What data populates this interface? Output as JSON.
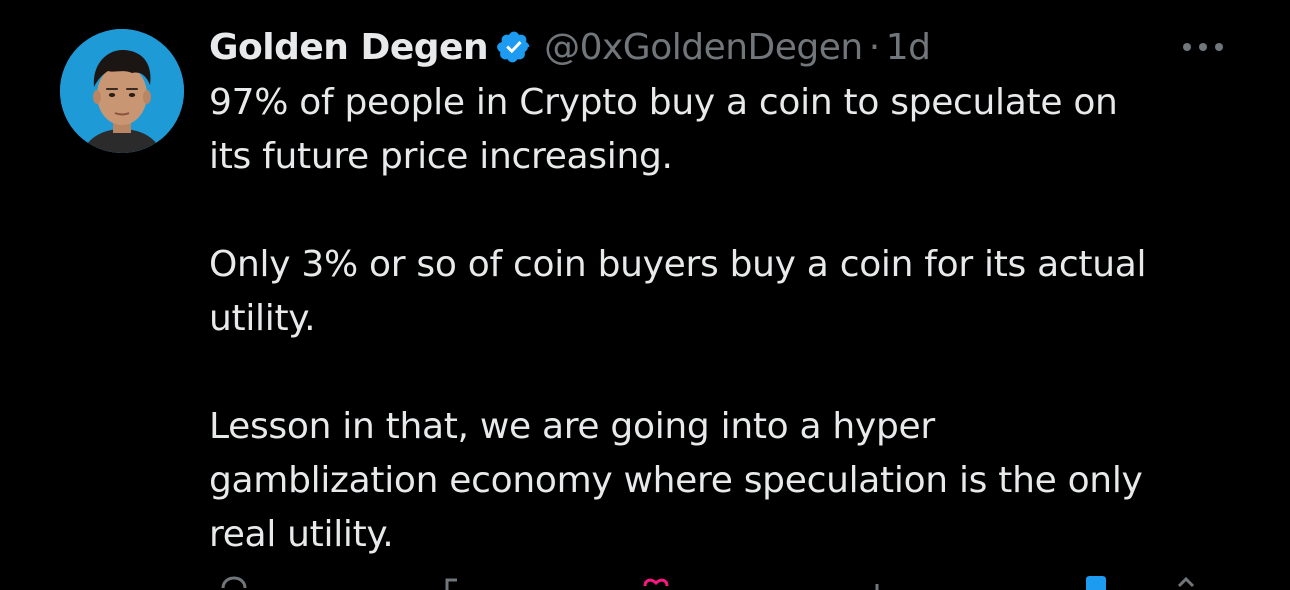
{
  "tweet": {
    "display_name": "Golden Degen",
    "handle": "@0xGoldenDegen",
    "separator": "·",
    "time": "1d",
    "verified": true,
    "paragraphs": [
      "97% of people in Crypto buy a coin to speculate on\nits future price increasing.",
      "Only 3% or so of coin buyers buy a coin for its actual\nutility.",
      "Lesson in that, we are going into a hyper\ngamblization economy where speculation is the only\nreal utility."
    ]
  },
  "icons": {
    "verified": "verified-badge-icon",
    "more": "more-options-icon",
    "reply": "reply-icon",
    "repost": "repost-icon",
    "like": "like-icon",
    "views": "views-icon",
    "bookmark": "bookmark-icon",
    "share": "share-icon"
  },
  "colors": {
    "background": "#000000",
    "text": "#e7e9ea",
    "muted": "#71767b",
    "verified": "#1d9bf0",
    "avatar_bg": "#1e9ad6",
    "like": "#f91880"
  }
}
